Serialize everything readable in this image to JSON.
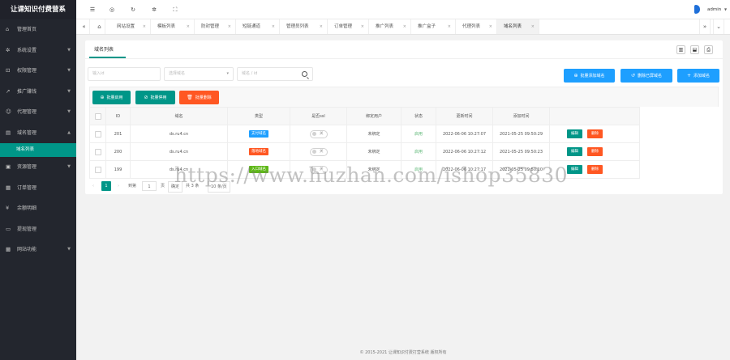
{
  "app": {
    "title": "让课知识付费营系"
  },
  "sidebar": {
    "items": [
      {
        "label": "管理首页",
        "icon": "home-icon",
        "has_arrow": false
      },
      {
        "label": "系统设置",
        "icon": "gear-icon",
        "has_arrow": true
      },
      {
        "label": "权限管理",
        "icon": "lock-icon",
        "has_arrow": true
      },
      {
        "label": "推广赚钱",
        "icon": "share-icon",
        "has_arrow": true
      },
      {
        "label": "代理管理",
        "icon": "user-icon",
        "has_arrow": true
      },
      {
        "label": "域名管理",
        "icon": "list-icon",
        "has_arrow": true
      },
      {
        "label": "资源管理",
        "icon": "folder-icon",
        "has_arrow": true
      },
      {
        "label": "订单管理",
        "icon": "document-icon",
        "has_arrow": false
      },
      {
        "label": "余额明细",
        "icon": "money-icon",
        "has_arrow": false
      },
      {
        "label": "提现管理",
        "icon": "wallet-icon",
        "has_arrow": false
      },
      {
        "label": "网站功能",
        "icon": "grid-icon",
        "has_arrow": true
      }
    ],
    "active_sub": "域名列表"
  },
  "header": {
    "icons": [
      "menu-icon",
      "globe-icon",
      "refresh-icon",
      "gear-icon",
      "fullscreen-icon"
    ],
    "user": "admin"
  },
  "tabs": {
    "items": [
      "网站设置",
      "模板列表",
      "防封管理",
      "短链通道",
      "管理员列表",
      "订单管理",
      "推广列表",
      "推广盒子",
      "代理列表",
      "域名列表"
    ],
    "active_index": 9
  },
  "card": {
    "tab_label": "域名列表",
    "filters": {
      "user_placeholder": "输入id",
      "type_placeholder": "选择域名",
      "domain_placeholder": "域名 / id"
    },
    "buttons": {
      "bulk_add": "批量添加域名",
      "delete_blocked": "删除已屏域名",
      "add_domain": "添加域名",
      "bulk_enable": "批量启用",
      "bulk_disable": "批量停用",
      "bulk_delete": "批量删除"
    },
    "table": {
      "headers": [
        "ID",
        "域名",
        "类型",
        "是否ssl",
        "绑定用户",
        "状态",
        "更新时间",
        "添加时间",
        ""
      ],
      "rows": [
        {
          "id": "201",
          "domain": "ds.ru4.cn",
          "type": "支付域名",
          "type_color": "#1e9fff",
          "ssl": "关",
          "user": "未绑定",
          "status": "启用",
          "updated": "2022-06-06 10:27:07",
          "created": "2021-05-25 09:50:29",
          "edit": "编辑",
          "delete": "删除"
        },
        {
          "id": "200",
          "domain": "ds.ru4.cn",
          "type": "落地域名",
          "type_color": "#ff5722",
          "ssl": "关",
          "user": "未绑定",
          "status": "启用",
          "updated": "2022-06-06 10:27:12",
          "created": "2021-05-25 09:50:23",
          "edit": "编辑",
          "delete": "删除"
        },
        {
          "id": "199",
          "domain": "ds.ru4.cn",
          "type": "入口域名",
          "type_color": "#5fb818",
          "ssl": "关",
          "user": "未绑定",
          "status": "启用",
          "updated": "2022-06-06 10:27:17",
          "created": "2021-05-25 09:50:10",
          "edit": "编辑",
          "delete": "删除"
        }
      ]
    },
    "pager": {
      "current": "1",
      "goto_label": "到第",
      "page_input": "1",
      "page_unit": "页",
      "confirm": "确定",
      "total": "共 3 条",
      "per_page": "10 条/页"
    }
  },
  "footer": {
    "text": "© 2015-2021 让课知识付费打营系统 版权所有"
  },
  "watermark": "https://www.huzhan.com/ishop35830"
}
